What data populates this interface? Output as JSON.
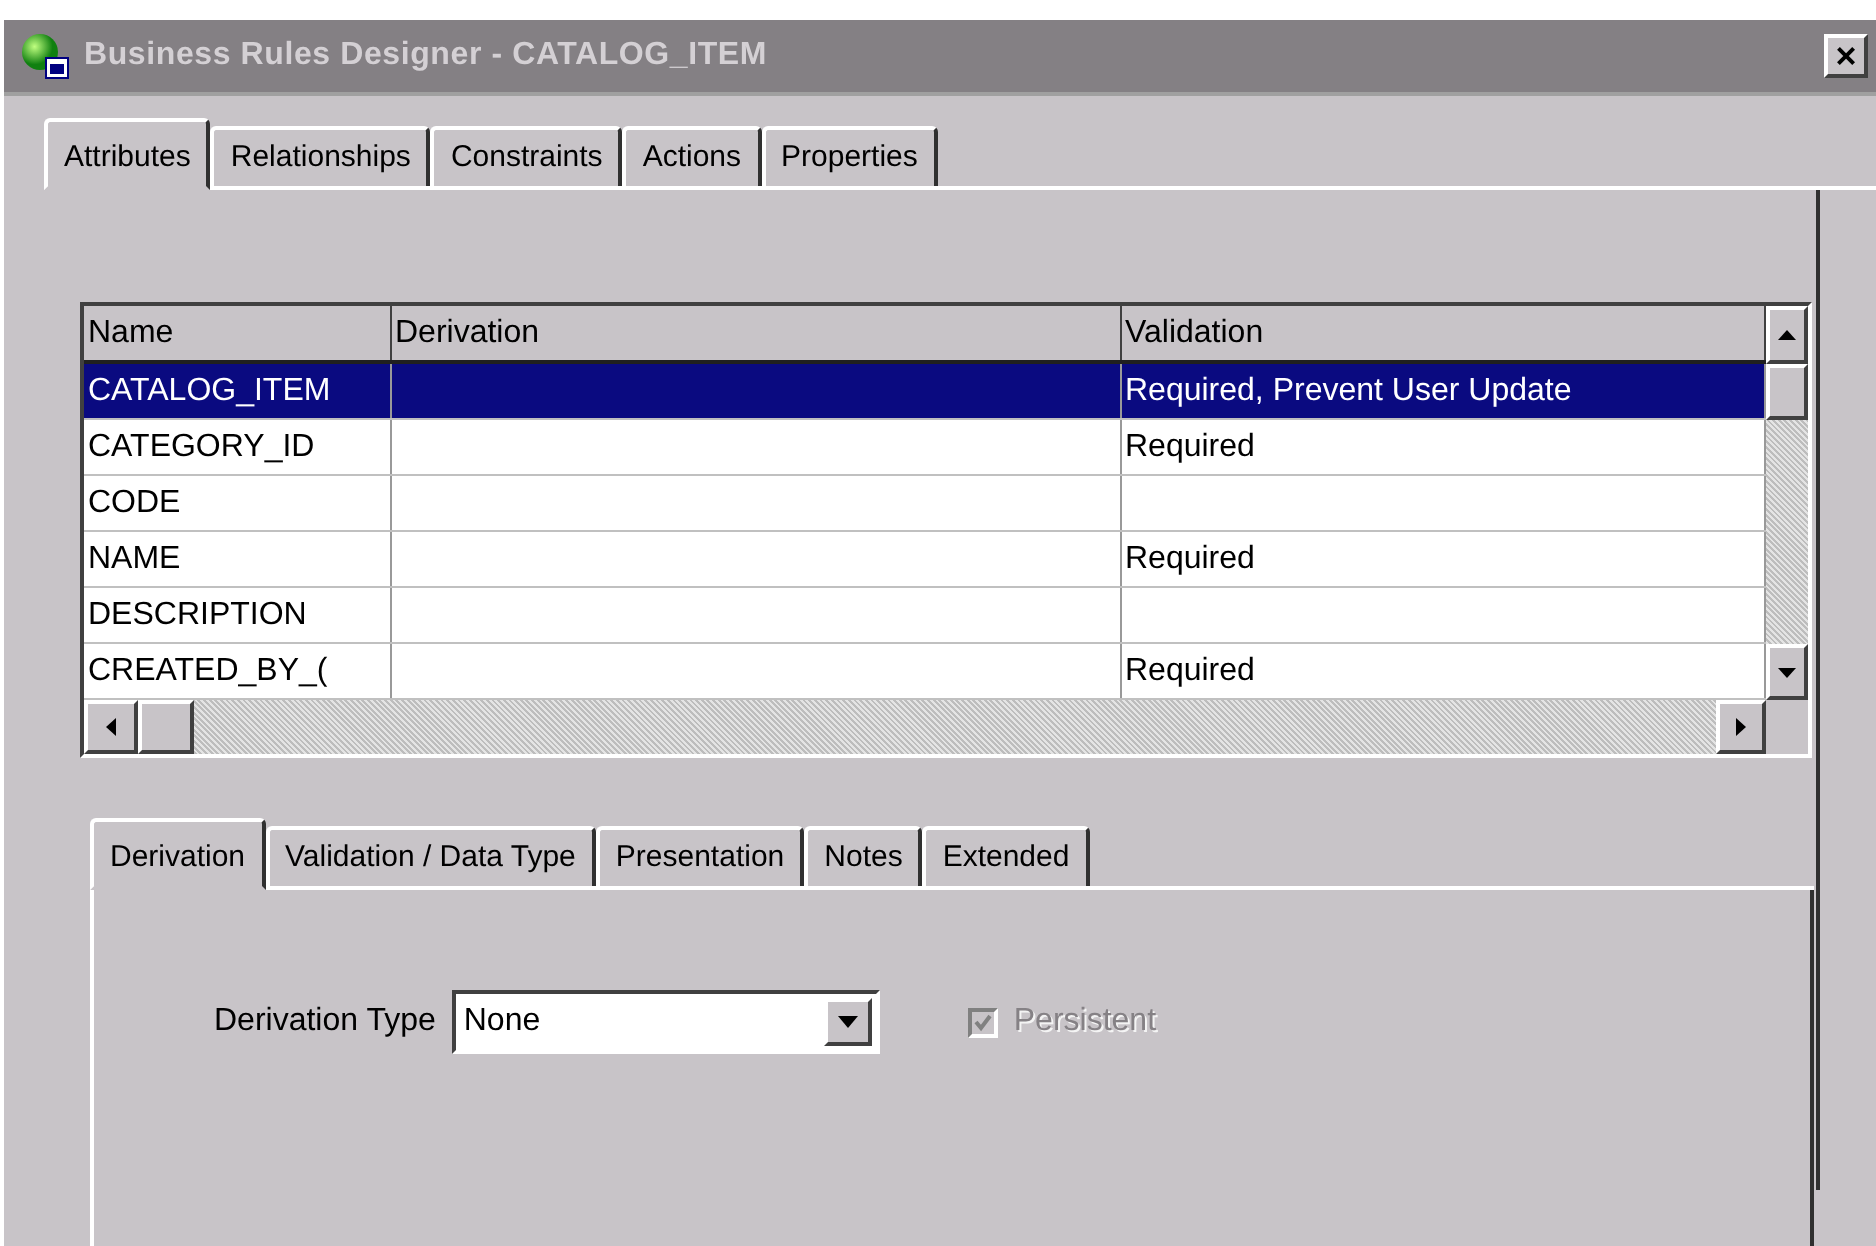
{
  "window": {
    "title": "Business Rules Designer - CATALOG_ITEM",
    "close": "×"
  },
  "tabs": [
    {
      "label": "Attributes",
      "selected": true
    },
    {
      "label": "Relationships",
      "selected": false
    },
    {
      "label": "Constraints",
      "selected": false
    },
    {
      "label": "Actions",
      "selected": false
    },
    {
      "label": "Properties",
      "selected": false
    }
  ],
  "table": {
    "columns": [
      "Name",
      "Derivation",
      "Validation"
    ],
    "rows": [
      {
        "cells": [
          "CATALOG_ITEM",
          "",
          "Required, Prevent User Update"
        ],
        "selected": true
      },
      {
        "cells": [
          "CATEGORY_ID",
          "",
          "Required"
        ],
        "selected": false
      },
      {
        "cells": [
          "CODE",
          "",
          ""
        ],
        "selected": false
      },
      {
        "cells": [
          "NAME",
          "",
          "Required"
        ],
        "selected": false
      },
      {
        "cells": [
          "DESCRIPTION",
          "",
          ""
        ],
        "selected": false
      },
      {
        "cells": [
          "CREATED_BY_(",
          "",
          "Required"
        ],
        "selected": false
      }
    ]
  },
  "detail_tabs": [
    {
      "label": "Derivation",
      "selected": true
    },
    {
      "label": "Validation / Data Type",
      "selected": false
    },
    {
      "label": "Presentation",
      "selected": false
    },
    {
      "label": "Notes",
      "selected": false
    },
    {
      "label": "Extended",
      "selected": false
    }
  ],
  "form": {
    "label": "Derivation Type",
    "value": "None",
    "checkbox": {
      "label": "Persistent",
      "checked": true,
      "disabled": true
    }
  }
}
